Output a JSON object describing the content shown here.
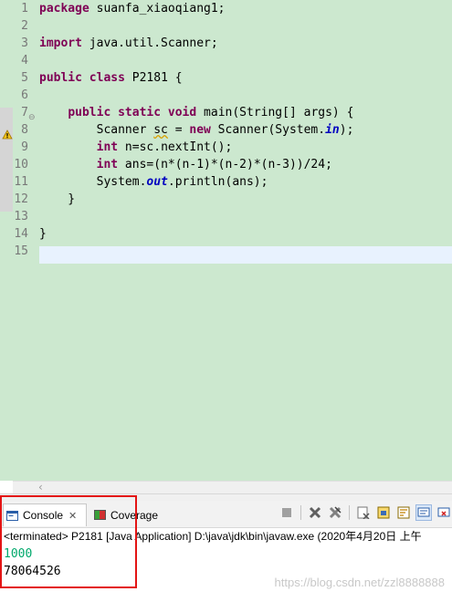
{
  "editor": {
    "line_numbers": [
      "1",
      "2",
      "3",
      "4",
      "5",
      "6",
      "7",
      "8",
      "9",
      "10",
      "11",
      "12",
      "13",
      "14",
      "15"
    ],
    "lines": [
      [
        {
          "t": "package",
          "c": "kw"
        },
        {
          "t": " suanfa_xiaoqiang1;",
          "c": ""
        }
      ],
      [],
      [
        {
          "t": "import",
          "c": "kw"
        },
        {
          "t": " java.util.Scanner;",
          "c": ""
        }
      ],
      [],
      [
        {
          "t": "public",
          "c": "kw"
        },
        {
          "t": " ",
          "c": ""
        },
        {
          "t": "class",
          "c": "kw"
        },
        {
          "t": " P2181 {",
          "c": ""
        }
      ],
      [],
      [
        {
          "t": "    ",
          "c": ""
        },
        {
          "t": "public",
          "c": "kw"
        },
        {
          "t": " ",
          "c": ""
        },
        {
          "t": "static",
          "c": "kw"
        },
        {
          "t": " ",
          "c": ""
        },
        {
          "t": "void",
          "c": "kw"
        },
        {
          "t": " main(String[] args) {",
          "c": ""
        }
      ],
      [
        {
          "t": "        Scanner ",
          "c": ""
        },
        {
          "t": "sc",
          "c": "warn-underline"
        },
        {
          "t": " = ",
          "c": ""
        },
        {
          "t": "new",
          "c": "kw"
        },
        {
          "t": " Scanner(System.",
          "c": ""
        },
        {
          "t": "in",
          "c": "fld"
        },
        {
          "t": ");",
          "c": ""
        }
      ],
      [
        {
          "t": "        ",
          "c": ""
        },
        {
          "t": "int",
          "c": "kw"
        },
        {
          "t": " n=sc.nextInt();",
          "c": ""
        }
      ],
      [
        {
          "t": "        ",
          "c": ""
        },
        {
          "t": "int",
          "c": "kw"
        },
        {
          "t": " ans=(n*(n-1)*(n-2)*(n-3))/24;",
          "c": ""
        }
      ],
      [
        {
          "t": "        System.",
          "c": ""
        },
        {
          "t": "out",
          "c": "fld"
        },
        {
          "t": ".println(ans);",
          "c": ""
        }
      ],
      [
        {
          "t": "    }",
          "c": ""
        }
      ],
      [],
      [
        {
          "t": "}",
          "c": ""
        }
      ],
      []
    ]
  },
  "console": {
    "tabs": [
      {
        "label": "Console",
        "icon": "console-icon",
        "closable": true
      },
      {
        "label": "Coverage",
        "icon": "coverage-icon",
        "closable": false
      }
    ],
    "status": "<terminated> P2181 [Java Application] D:\\java\\jdk\\bin\\javaw.exe (2020年4月20日 上午",
    "input_line": "1000",
    "output_line": "78064526"
  },
  "watermark": "https://blog.csdn.net/zzl8888888",
  "colors": {
    "editor_bg": "#cce8cf",
    "keyword": "#7f0055",
    "static_field": "#0000c0",
    "stdin_text": "#00a86b",
    "highlight_box": "#e31414"
  }
}
